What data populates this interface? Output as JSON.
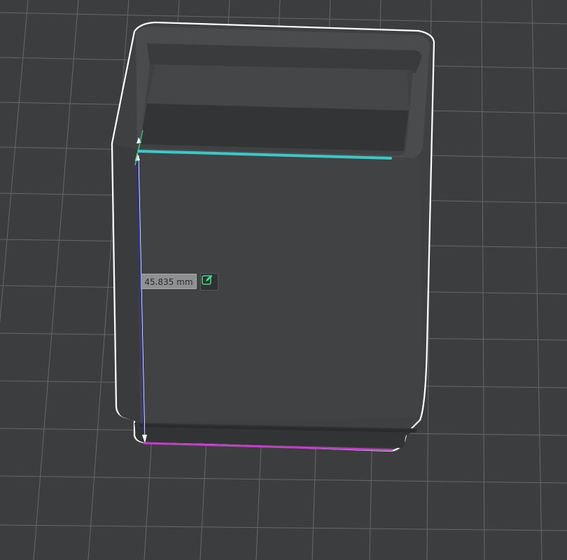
{
  "viewport": {
    "background": "#3c3d3e",
    "grid_color": "#8a8b8c",
    "model_color": "#3d3e3f",
    "outline_color": "#ffffff"
  },
  "measurement": {
    "value": "45.835 mm",
    "edit_icon": "edit-pencil-icon",
    "icon_color": "#3ddc84",
    "dimension_color": "#2a2aa8"
  },
  "selection": {
    "top_edge_color": "#3bc8c8",
    "bottom_edge_color": "#c040c8"
  }
}
